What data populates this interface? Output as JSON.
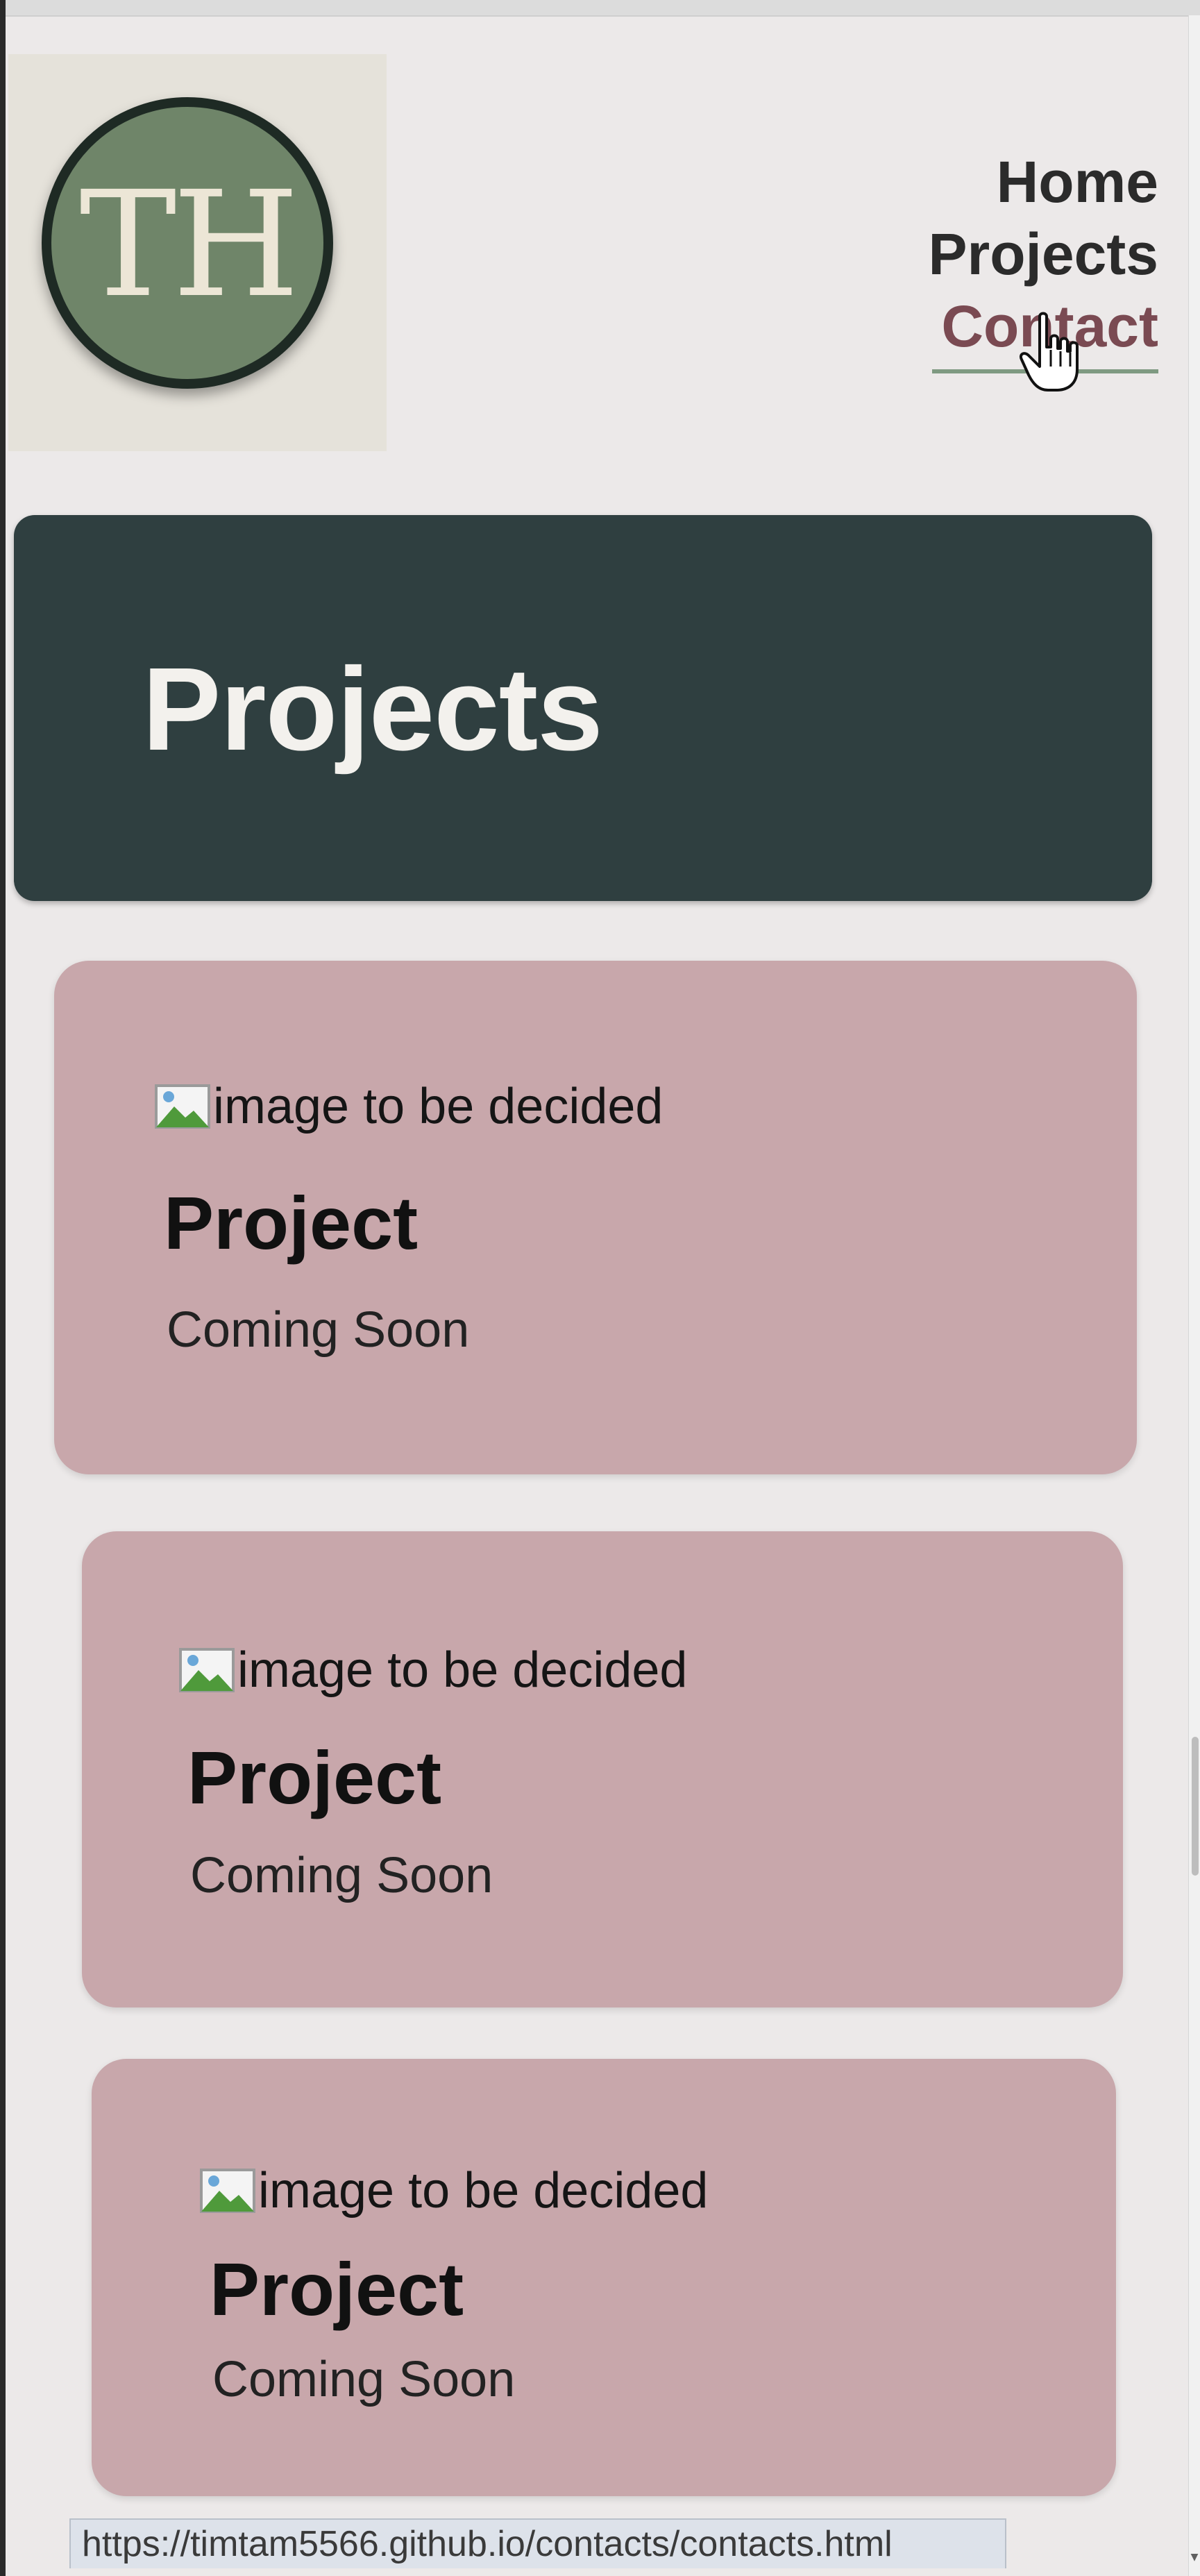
{
  "header": {
    "logo_text": "TH",
    "nav": [
      {
        "label": "Home"
      },
      {
        "label": "Projects"
      },
      {
        "label": "Contact"
      }
    ]
  },
  "banner": {
    "title": "Projects"
  },
  "projects": [
    {
      "image_alt": "image to be decided",
      "title": "Project",
      "subtitle": "Coming Soon"
    },
    {
      "image_alt": "image to be decided",
      "title": "Project",
      "subtitle": "Coming Soon"
    },
    {
      "image_alt": "image to be decided",
      "title": "Project",
      "subtitle": "Coming Soon"
    }
  ],
  "status_bar": {
    "url": "https://timtam5566.github.io/contacts/contacts.html"
  },
  "colors": {
    "page_bg": "#ece9e9",
    "banner_bg": "#2f3f40",
    "card_bg": "#c8a7ab",
    "logo_green": "#6f8569",
    "nav_active": "#7a4a52",
    "nav_underline": "#7f9a82"
  },
  "icons": {
    "broken_image": "broken-image-icon",
    "cursor": "hand-pointer-icon",
    "scroll_down": "scroll-down-arrow-icon"
  }
}
